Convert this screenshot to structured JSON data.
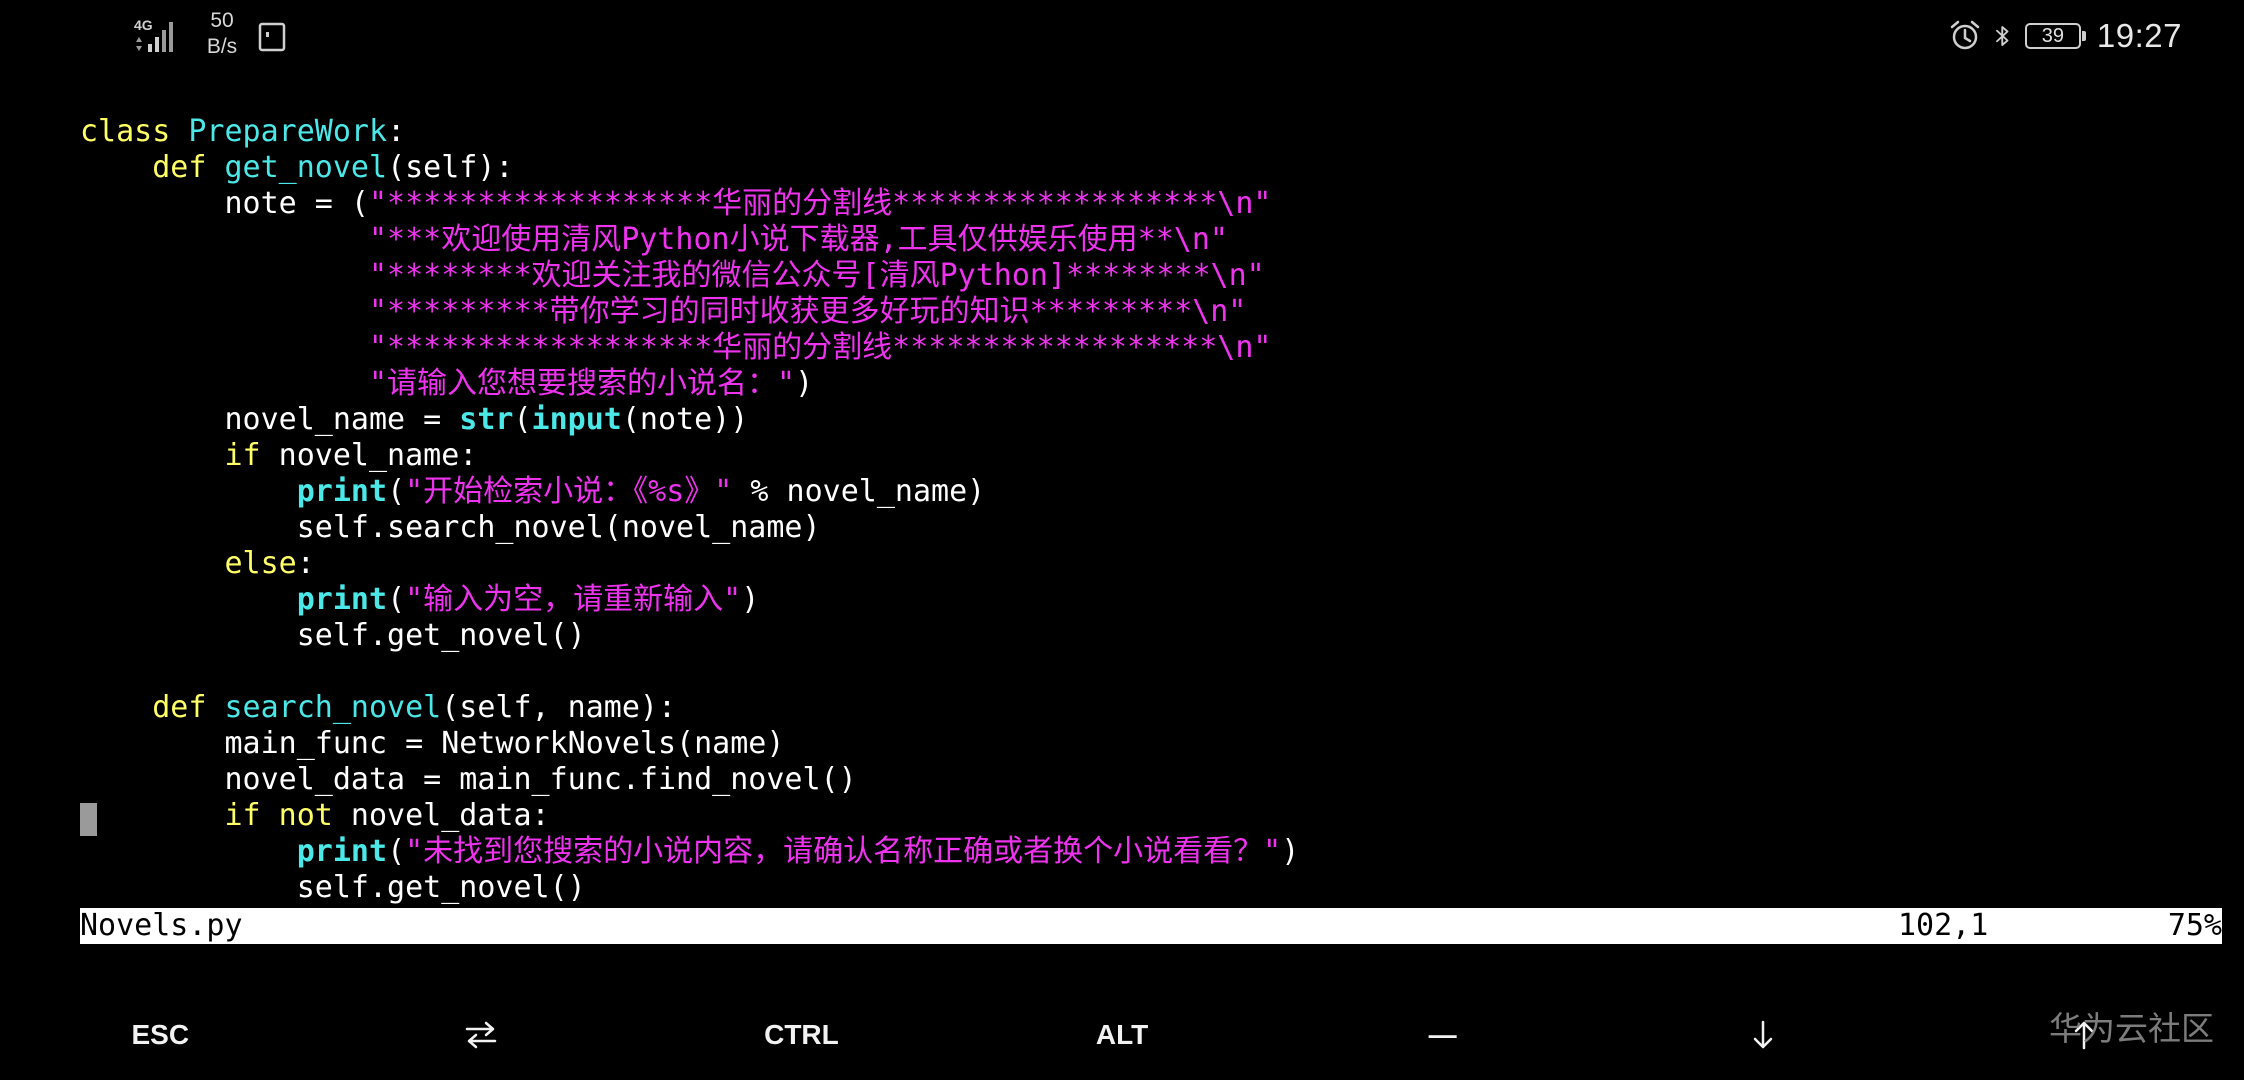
{
  "status_bar": {
    "network_type": "4G",
    "net_speed_value": "50",
    "net_speed_unit": "B/s",
    "battery_level": "39",
    "time": "19:27",
    "icons": [
      "signal-icon",
      "screen-record-icon",
      "alarm-icon",
      "bluetooth-icon",
      "battery-icon"
    ]
  },
  "editor": {
    "lines": [
      [
        {
          "t": "class ",
          "c": "kw"
        },
        {
          "t": "PrepareWork",
          "c": "cls"
        },
        {
          "t": ":",
          "c": "n"
        }
      ],
      [
        {
          "t": "    ",
          "c": "n"
        },
        {
          "t": "def ",
          "c": "kw"
        },
        {
          "t": "get_novel",
          "c": "fn"
        },
        {
          "t": "(self):",
          "c": "n"
        }
      ],
      [
        {
          "t": "        note = (",
          "c": "n"
        },
        {
          "t": "\"******************华丽的分割线******************\\n\"",
          "c": "str"
        }
      ],
      [
        {
          "t": "                ",
          "c": "n"
        },
        {
          "t": "\"***欢迎使用清风Python小说下载器,工具仅供娱乐使用**\\n\"",
          "c": "str"
        }
      ],
      [
        {
          "t": "                ",
          "c": "n"
        },
        {
          "t": "\"********欢迎关注我的微信公众号[清风Python]********\\n\"",
          "c": "str"
        }
      ],
      [
        {
          "t": "                ",
          "c": "n"
        },
        {
          "t": "\"*********带你学习的同时收获更多好玩的知识*********\\n\"",
          "c": "str"
        }
      ],
      [
        {
          "t": "                ",
          "c": "n"
        },
        {
          "t": "\"******************华丽的分割线******************\\n\"",
          "c": "str"
        }
      ],
      [
        {
          "t": "                ",
          "c": "n"
        },
        {
          "t": "\"请输入您想要搜索的小说名：\"",
          "c": "str"
        },
        {
          "t": ")",
          "c": "n"
        }
      ],
      [
        {
          "t": "        novel_name = ",
          "c": "n"
        },
        {
          "t": "str",
          "c": "bi"
        },
        {
          "t": "(",
          "c": "n"
        },
        {
          "t": "input",
          "c": "bi"
        },
        {
          "t": "(note))",
          "c": "n"
        }
      ],
      [
        {
          "t": "        ",
          "c": "n"
        },
        {
          "t": "if",
          "c": "kw"
        },
        {
          "t": " novel_name:",
          "c": "n"
        }
      ],
      [
        {
          "t": "            ",
          "c": "n"
        },
        {
          "t": "print",
          "c": "bi"
        },
        {
          "t": "(",
          "c": "n"
        },
        {
          "t": "\"开始检索小说：《%s》\"",
          "c": "str"
        },
        {
          "t": " % novel_name)",
          "c": "n"
        }
      ],
      [
        {
          "t": "            self.search_novel(novel_name)",
          "c": "n"
        }
      ],
      [
        {
          "t": "        ",
          "c": "n"
        },
        {
          "t": "else",
          "c": "kw"
        },
        {
          "t": ":",
          "c": "n"
        }
      ],
      [
        {
          "t": "            ",
          "c": "n"
        },
        {
          "t": "print",
          "c": "bi"
        },
        {
          "t": "(",
          "c": "n"
        },
        {
          "t": "\"输入为空，请重新输入\"",
          "c": "str"
        },
        {
          "t": ")",
          "c": "n"
        }
      ],
      [
        {
          "t": "            self.get_novel()",
          "c": "n"
        }
      ],
      [
        {
          "t": "",
          "c": "n"
        }
      ],
      [
        {
          "t": "    ",
          "c": "n"
        },
        {
          "t": "def ",
          "c": "kw"
        },
        {
          "t": "search_novel",
          "c": "fn"
        },
        {
          "t": "(self, name):",
          "c": "n"
        }
      ],
      [
        {
          "t": "        main_func = NetworkNovels(name)",
          "c": "n"
        }
      ],
      [
        {
          "t": "        novel_data = main_func.find_novel()",
          "c": "n"
        }
      ],
      [
        {
          "t": "        ",
          "c": "n"
        },
        {
          "t": "if not",
          "c": "kw"
        },
        {
          "t": " novel_data:",
          "c": "n"
        }
      ],
      [
        {
          "t": "            ",
          "c": "n"
        },
        {
          "t": "print",
          "c": "bi"
        },
        {
          "t": "(",
          "c": "n"
        },
        {
          "t": "\"未找到您搜索的小说内容，请确认名称正确或者换个小说看看？\"",
          "c": "str"
        },
        {
          "t": ")",
          "c": "n"
        }
      ],
      [
        {
          "t": "            self.get_novel()",
          "c": "n"
        }
      ]
    ],
    "statusline": {
      "filename": "Novels.py",
      "position": "102,1",
      "percent": "75%"
    }
  },
  "extra_keys": {
    "esc": "ESC",
    "tab_icon": "swap-arrows-icon",
    "ctrl": "CTRL",
    "alt": "ALT",
    "dash": "—",
    "down_icon": "arrow-down-icon",
    "up_icon": "arrow-up-icon"
  },
  "watermark": "华为云社区",
  "colors": {
    "background": "#000000",
    "keyword": "#ffff66",
    "function": "#4ce8e8",
    "string": "#ee33ee",
    "text": "#ffffff"
  }
}
